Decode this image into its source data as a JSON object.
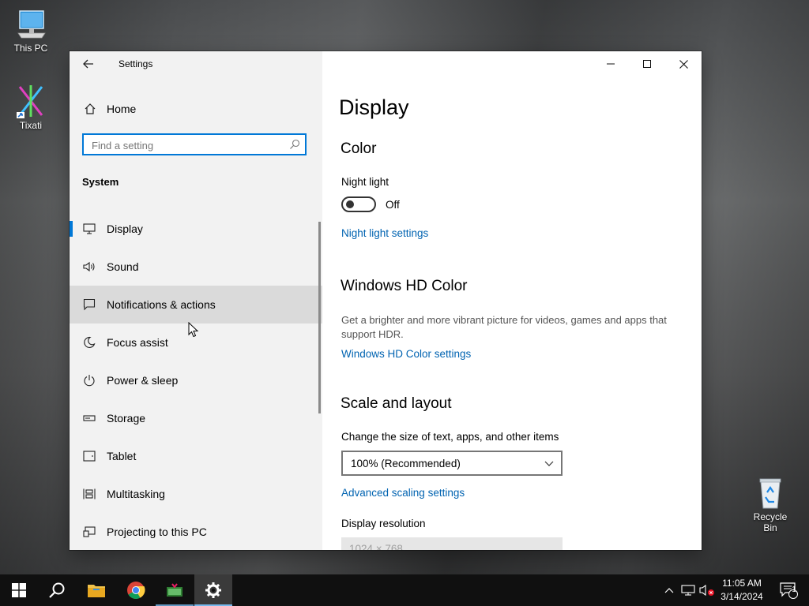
{
  "desktop": {
    "icons": [
      {
        "label": "This PC"
      },
      {
        "label": "Tixati"
      },
      {
        "label": "Recycle Bin"
      }
    ]
  },
  "window": {
    "title": "Settings",
    "sidebar": {
      "home_label": "Home",
      "search_placeholder": "Find a setting",
      "section_label": "System",
      "items": [
        {
          "label": "Display",
          "icon": "monitor-icon",
          "selected": true
        },
        {
          "label": "Sound",
          "icon": "speaker-icon"
        },
        {
          "label": "Notifications & actions",
          "icon": "notification-icon",
          "hovered": true
        },
        {
          "label": "Focus assist",
          "icon": "moon-icon"
        },
        {
          "label": "Power & sleep",
          "icon": "power-icon"
        },
        {
          "label": "Storage",
          "icon": "storage-icon"
        },
        {
          "label": "Tablet",
          "icon": "tablet-icon"
        },
        {
          "label": "Multitasking",
          "icon": "multitasking-icon"
        },
        {
          "label": "Projecting to this PC",
          "icon": "projector-icon"
        }
      ]
    },
    "content": {
      "title": "Display",
      "color_heading": "Color",
      "night_light_label": "Night light",
      "night_light_state": "Off",
      "night_light_link": "Night light settings",
      "hd_color_heading": "Windows HD Color",
      "hd_color_desc": "Get a brighter and more vibrant picture for videos, games and apps that support HDR.",
      "hd_color_link": "Windows HD Color settings",
      "scale_heading": "Scale and layout",
      "scale_label": "Change the size of text, apps, and other items",
      "scale_value": "100% (Recommended)",
      "advanced_scaling_link": "Advanced scaling settings",
      "resolution_label": "Display resolution",
      "resolution_value": "1024 × 768"
    }
  },
  "taskbar": {
    "time": "11:05 AM",
    "date": "3/14/2024",
    "notification_count": "1"
  },
  "colors": {
    "accent": "#0078d7",
    "link": "#0063b1"
  }
}
